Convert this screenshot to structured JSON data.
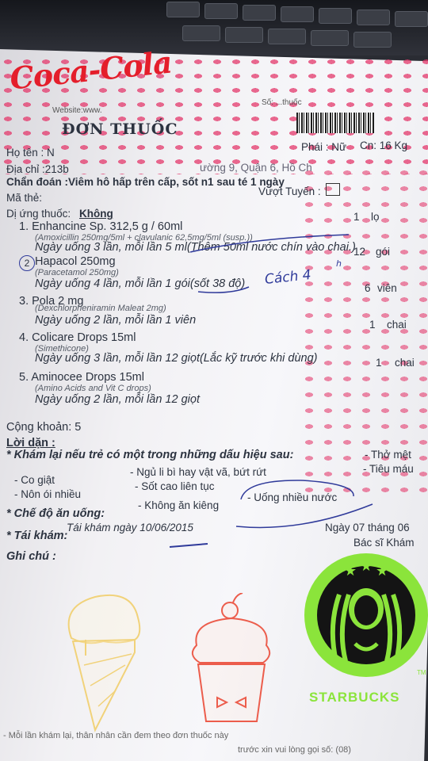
{
  "stickers": {
    "coca_cola": "Coca-Cola",
    "starbucks": "STARBUCKS",
    "tm": "TM"
  },
  "header": {
    "website": "Website:www.",
    "doc_no": "Số: ...thuốc",
    "title": "ĐƠN THUỐC",
    "ho_ten": "Họ tên : N",
    "phai": "Phái : Nữ",
    "can": "Cn: 16 Kg",
    "dia_chi": "Địa chỉ :213b",
    "dia_chi_tail": "ường 9, Quận 6, Hồ Ch",
    "chan_doan": "Chẩn đoán :Viêm  hô hấp trên cấp, sốt n1  sau té 1 ngày",
    "ma_the": "Mã thẻ:",
    "vuot_tuyen": "Vượt Tuyến :",
    "di_ung_label": "Dị ứng thuốc:",
    "di_ung_value": "Không"
  },
  "meds": [
    {
      "name": "1.  Enhancine  Sp.  312,5 g / 60ml",
      "sub": "(Amoxicillin 250mg/5ml + clavulanic 62,5mg/5ml (susp.))",
      "dose": "Ngày uống 3 lần, mỗi lần 5 ml(Thêm 50ml nước chín vào chai.)",
      "qty": "1",
      "unit": "lọ"
    },
    {
      "name": "Hapacol 250mg",
      "num": "2",
      "sub": "(Paracetamol 250mg)",
      "dose": "Ngày uống 4 lần, mỗi lần 1 gói(sốt 38 độ)",
      "qty": "12",
      "unit": "gói"
    },
    {
      "name": "3.  Pola   2 mg",
      "sub": "(Dexchlorpheniramin Maleat 2mg)",
      "dose": "Ngày uống 2 lần, mỗi lần 1 viên",
      "qty": "6",
      "unit": "viên"
    },
    {
      "name": "4.  Colicare Drops 15ml",
      "sub": "(Simethicone)",
      "dose": "Ngày uống 3 lần, mỗi lần 12 giọt(Lắc kỹ trước khi dùng)",
      "qty": "1",
      "unit": "chai"
    },
    {
      "name": "5.  Aminocee Drops 15ml",
      "sub": "(Amino Acids and Vit C drops)",
      "dose": "Ngày uống 2 lần, mỗi lần 12 giọt",
      "qty": "1",
      "unit": "chai"
    }
  ],
  "handwriting": {
    "cach": "Cách 4",
    "sup": "h"
  },
  "cong_khoan": "Cộng khoản: 5",
  "loi_dan": {
    "title": "Lời dặn :",
    "kham_lai": "* Khám lại nếu trẻ có một trong những dấu hiệu sau:",
    "signs": [
      "- Co giật",
      "- Ngủ li bì hay vật vã, bứt rứt",
      "- Thở mệt",
      "- Tiêu máu",
      "- Nôn ói nhiều",
      "- Sốt cao liên tục"
    ],
    "che_do": "* Chế độ ăn uống:",
    "khong_an_kieng": "- Không ăn kiêng",
    "uong_nuoc": "- Uống nhiều nước",
    "tai_kham": "* Tái khám:",
    "tai_kham_value": "Tái khám ngày 10/06/2015",
    "ghi_chu": "Ghi chú  :",
    "ngay": "Ngày 07 tháng 06",
    "bac_si": "Bác sĩ Khám",
    "footer1": "- Mỗi lần khám lại, thân nhân cần đem theo đơn thuốc này",
    "footer2": "trước xin vui lòng gọi số: (08)"
  }
}
